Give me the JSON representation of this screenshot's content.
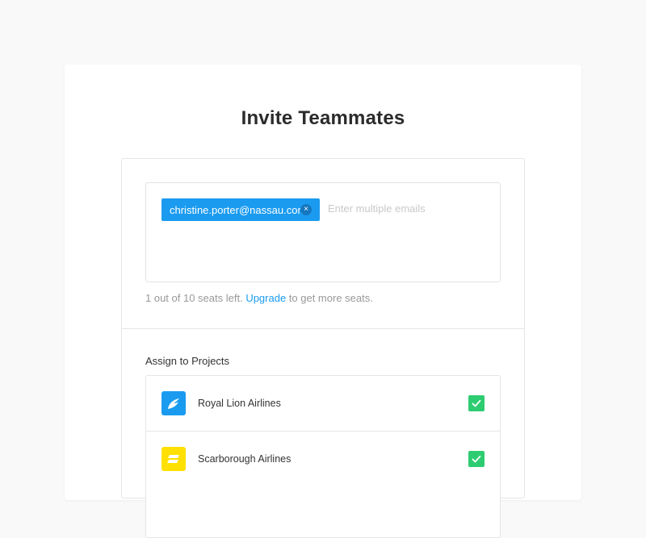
{
  "dialog": {
    "title": "Invite Teammates"
  },
  "invite": {
    "chips": [
      {
        "email": "christine.porter@nassau.com",
        "remove_glyph": "×"
      }
    ],
    "input_placeholder": "Enter multiple emails",
    "input_value": ""
  },
  "seats": {
    "text_before": "1 out of 10 seats left. ",
    "link_label": "Upgrade",
    "text_after": " to get more seats."
  },
  "projects": {
    "label": "Assign to Projects",
    "items": [
      {
        "name": "Royal Lion Airlines",
        "logo_icon": "wing-logo-icon",
        "logo_color": "#1a9bf0",
        "checked": true
      },
      {
        "name": "Scarborough Airlines",
        "logo_icon": "stripes-logo-icon",
        "logo_color": "#ffe000",
        "checked": true
      }
    ]
  },
  "colors": {
    "accent": "#1a9bf0",
    "check": "#2ecc71",
    "background": "#f9f9f9"
  }
}
